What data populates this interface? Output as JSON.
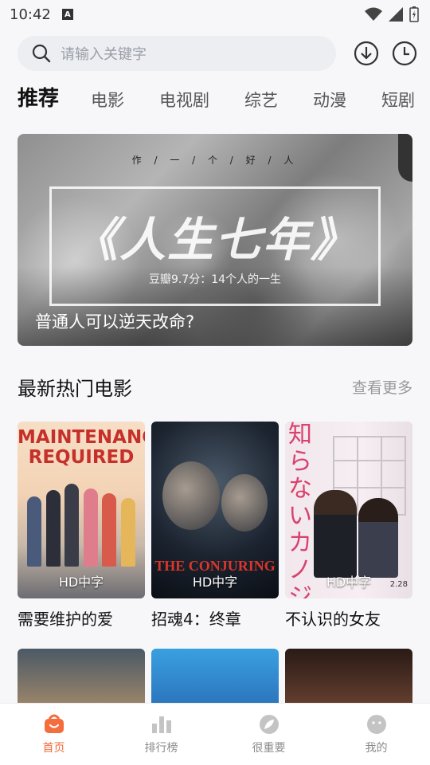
{
  "status": {
    "time": "10:42",
    "badge": "A"
  },
  "search": {
    "placeholder": "请输入关键字"
  },
  "tabs": [
    {
      "label": "推荐"
    },
    {
      "label": "电影"
    },
    {
      "label": "电视剧"
    },
    {
      "label": "综艺"
    },
    {
      "label": "动漫"
    },
    {
      "label": "短剧"
    }
  ],
  "banner": {
    "kicker": "作 / 一 / 个 / 好 / 人",
    "title": "《人生七年》",
    "subtitle": "豆瓣9.7分：14个人的一生",
    "caption": "普通人可以逆天改命?"
  },
  "section": {
    "title": "最新热门电影",
    "more": "查看更多"
  },
  "movies": [
    {
      "name": "需要维护的爱",
      "badge": "HD中字",
      "poster_text": "MAINTENANCE REQUIRED"
    },
    {
      "name": "招魂4：终章",
      "badge": "HD中字",
      "poster_text": "THE CONJURING"
    },
    {
      "name": "不认识的女友",
      "badge": "HD中字",
      "poster_text": "知らないカノジョ",
      "poster_date": "2.28"
    }
  ],
  "bottom_nav": [
    {
      "label": "首页",
      "icon": "home-icon"
    },
    {
      "label": "排行榜",
      "icon": "ranking-icon"
    },
    {
      "label": "很重要",
      "icon": "leaf-icon"
    },
    {
      "label": "我的",
      "icon": "profile-icon"
    }
  ],
  "colors": {
    "accent": "#f36d3d",
    "text": "#222222",
    "muted": "#999999"
  }
}
